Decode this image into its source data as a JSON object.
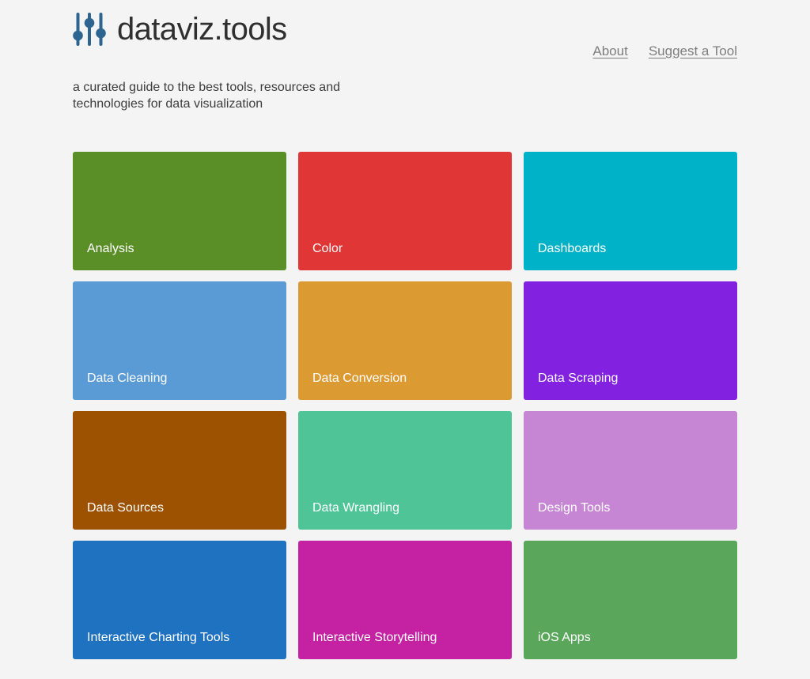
{
  "site": {
    "brand_name": "dataviz.tools",
    "logo_icon": "sliders-icon",
    "logo_color": "#2d6590",
    "tagline": "a curated guide to the best tools, resources and technologies for data visualization",
    "background_color": "#f4f4f4"
  },
  "nav": {
    "links": [
      {
        "label": "About",
        "name": "nav-link-about"
      },
      {
        "label": "Suggest a Tool",
        "name": "nav-link-suggest-a-tool"
      }
    ]
  },
  "categories": [
    {
      "label": "Analysis",
      "color": "#5a8f27"
    },
    {
      "label": "Color",
      "color": "#e03636"
    },
    {
      "label": "Dashboards",
      "color": "#00b2c8"
    },
    {
      "label": "Data Cleaning",
      "color": "#5b9bd5"
    },
    {
      "label": "Data Conversion",
      "color": "#dc9a33"
    },
    {
      "label": "Data Scraping",
      "color": "#8321e0"
    },
    {
      "label": "Data Sources",
      "color": "#9c5200"
    },
    {
      "label": "Data Wrangling",
      "color": "#4ec497"
    },
    {
      "label": "Design Tools",
      "color": "#c686d4"
    },
    {
      "label": "Interactive Charting Tools",
      "color": "#1f72bf"
    },
    {
      "label": "Interactive Storytelling",
      "color": "#c421a3"
    },
    {
      "label": "iOS Apps",
      "color": "#5aa75c"
    }
  ]
}
